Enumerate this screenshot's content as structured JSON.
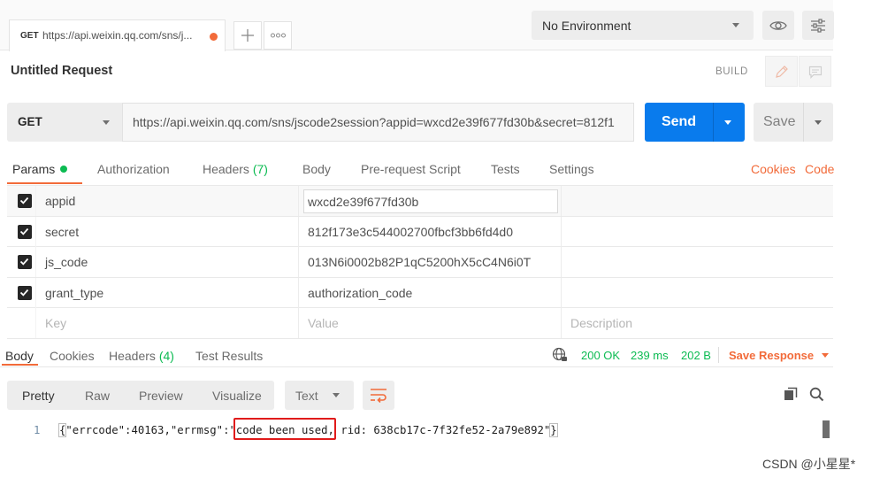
{
  "tab_bar": {
    "active_tab": {
      "method": "GET",
      "title": "https://api.weixin.qq.com/sns/j..."
    }
  },
  "environment": {
    "selected": "No Environment"
  },
  "request": {
    "name": "Untitled Request",
    "mode_label": "BUILD",
    "method": "GET",
    "url": "https://api.weixin.qq.com/sns/jscode2session?appid=wxcd2e39f677fd30b&secret=812f1",
    "send_label": "Send",
    "save_label": "Save"
  },
  "request_tabs": [
    {
      "label": "Params",
      "active": true
    },
    {
      "label": "Authorization"
    },
    {
      "label": "Headers",
      "count": "(7)"
    },
    {
      "label": "Body"
    },
    {
      "label": "Pre-request Script"
    },
    {
      "label": "Tests"
    },
    {
      "label": "Settings"
    }
  ],
  "request_links": {
    "cookies": "Cookies",
    "code": "Code"
  },
  "params": {
    "rows": [
      {
        "checked": true,
        "key": "appid",
        "value": "wxcd2e39f677fd30b"
      },
      {
        "checked": true,
        "key": "secret",
        "value": "812f173e3c544002700fbcf3bb6fd4d0"
      },
      {
        "checked": true,
        "key": "js_code",
        "value": "013N6i0002b82P1qC5200hX5cC4N6i0T"
      },
      {
        "checked": true,
        "key": "grant_type",
        "value": "authorization_code"
      }
    ],
    "new_row_placeholders": {
      "key": "Key",
      "value": "Value",
      "description": "Description"
    }
  },
  "response": {
    "tabs": [
      {
        "label": "Body",
        "active": true
      },
      {
        "label": "Cookies"
      },
      {
        "label": "Headers",
        "count": "(4)"
      },
      {
        "label": "Test Results"
      }
    ],
    "status": "200 OK",
    "time": "239 ms",
    "size": "202 B",
    "save_response_label": "Save Response",
    "view_modes": [
      {
        "label": "Pretty",
        "active": true
      },
      {
        "label": "Raw"
      },
      {
        "label": "Preview"
      },
      {
        "label": "Visualize"
      }
    ],
    "format": "Text",
    "body_lines": [
      {
        "number": "1",
        "open_brace": "{",
        "before": "\"errcode\":40163,\"errmsg\":\"",
        "highlighted": "code been used,",
        "after": " rid: 638cb17c-7f32fe52-2a79e892\"",
        "close_brace": "}"
      }
    ]
  },
  "watermark": "CSDN @小星星*",
  "colors": {
    "accent_orange": "#f26b3a",
    "success_green": "#0cbb52",
    "send_blue": "#097bed",
    "annotation_red": "#e01b1b"
  },
  "icons": {
    "unsaved": "orange-dot-icon",
    "new_tab": "plus-icon",
    "more_tabs": "more-horizontal-icon",
    "environment_quick_look": "eye-icon",
    "manage_environments": "sliders-icon",
    "edit": "pencil-icon",
    "comments": "comment-icon",
    "params_indicator": "green-dot-icon",
    "checkbox": "checkbox-checked-icon",
    "network": "globe-icon",
    "wrap": "wrap-lines-icon",
    "copy": "copy-icon",
    "search": "search-icon",
    "dropdown": "caret-down-icon"
  }
}
